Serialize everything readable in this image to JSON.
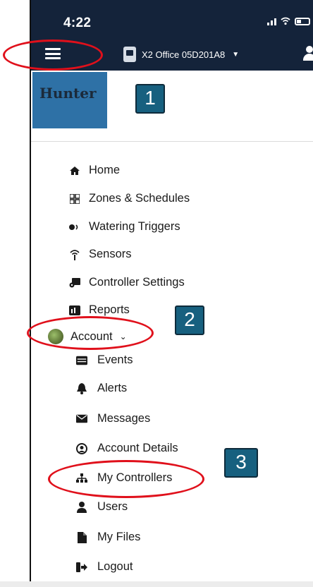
{
  "status_bar": {
    "time": "4:22"
  },
  "header": {
    "controller_name": "X2 Office 05D201A8"
  },
  "logo": {
    "text": "Hunter"
  },
  "callouts": [
    "1",
    "2",
    "3"
  ],
  "menu": {
    "items": [
      {
        "label": "Home",
        "icon": "home-icon"
      },
      {
        "label": "Zones & Schedules",
        "icon": "zones-icon"
      },
      {
        "label": "Watering Triggers",
        "icon": "triggers-icon"
      },
      {
        "label": "Sensors",
        "icon": "sensor-icon"
      },
      {
        "label": "Controller Settings",
        "icon": "controller-settings-icon"
      },
      {
        "label": "Reports",
        "icon": "reports-icon"
      }
    ],
    "account": {
      "label": "Account"
    },
    "account_items": [
      {
        "label": "Events",
        "icon": "events-icon"
      },
      {
        "label": "Alerts",
        "icon": "bell-icon"
      },
      {
        "label": "Messages",
        "icon": "envelope-icon"
      },
      {
        "label": "Account Details",
        "icon": "user-circle-icon"
      },
      {
        "label": "My Controllers",
        "icon": "sitemap-icon"
      },
      {
        "label": "Users",
        "icon": "user-icon"
      },
      {
        "label": "My Files",
        "icon": "file-icon"
      },
      {
        "label": "Logout",
        "icon": "logout-icon"
      }
    ]
  },
  "colors": {
    "header_bg": "#14233a",
    "logo_bg": "#2e71a6",
    "callout_bg": "#17607f",
    "highlight_ring": "#e0101b"
  }
}
